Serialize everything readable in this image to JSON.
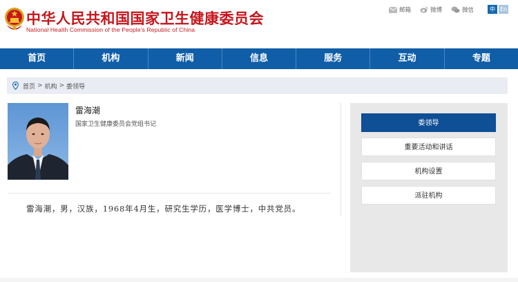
{
  "header": {
    "title_cn": "中华人民共和国国家卫生健康委员会",
    "title_en": "National Health Commission of the People’s Republic of China",
    "links": [
      {
        "label": "邮箱",
        "icon": "mail-icon"
      },
      {
        "label": "微博",
        "icon": "weibo-icon"
      },
      {
        "label": "微信",
        "icon": "wechat-icon"
      }
    ],
    "lang": {
      "cn": "中",
      "en": "En"
    }
  },
  "nav": {
    "items": [
      "首页",
      "机构",
      "新闻",
      "信息",
      "服务",
      "互动",
      "专题"
    ]
  },
  "breadcrumb": {
    "items": [
      "首页",
      "机构",
      "委领导"
    ],
    "separator": ">"
  },
  "profile": {
    "name": "雷海潮",
    "title": "国家卫生健康委员会党组书记",
    "bio": "雷海潮，男，汉族，1968年4月生，研究生学历，医学博士，中共党员。"
  },
  "side_menu": {
    "items": [
      "委领导",
      "重要活动和讲话",
      "机构设置",
      "派驻机构"
    ],
    "active_index": 0
  },
  "colors": {
    "brand_red": "#c4161c",
    "nav_blue": "#105ea8",
    "active_blue": "#0f4f95"
  }
}
